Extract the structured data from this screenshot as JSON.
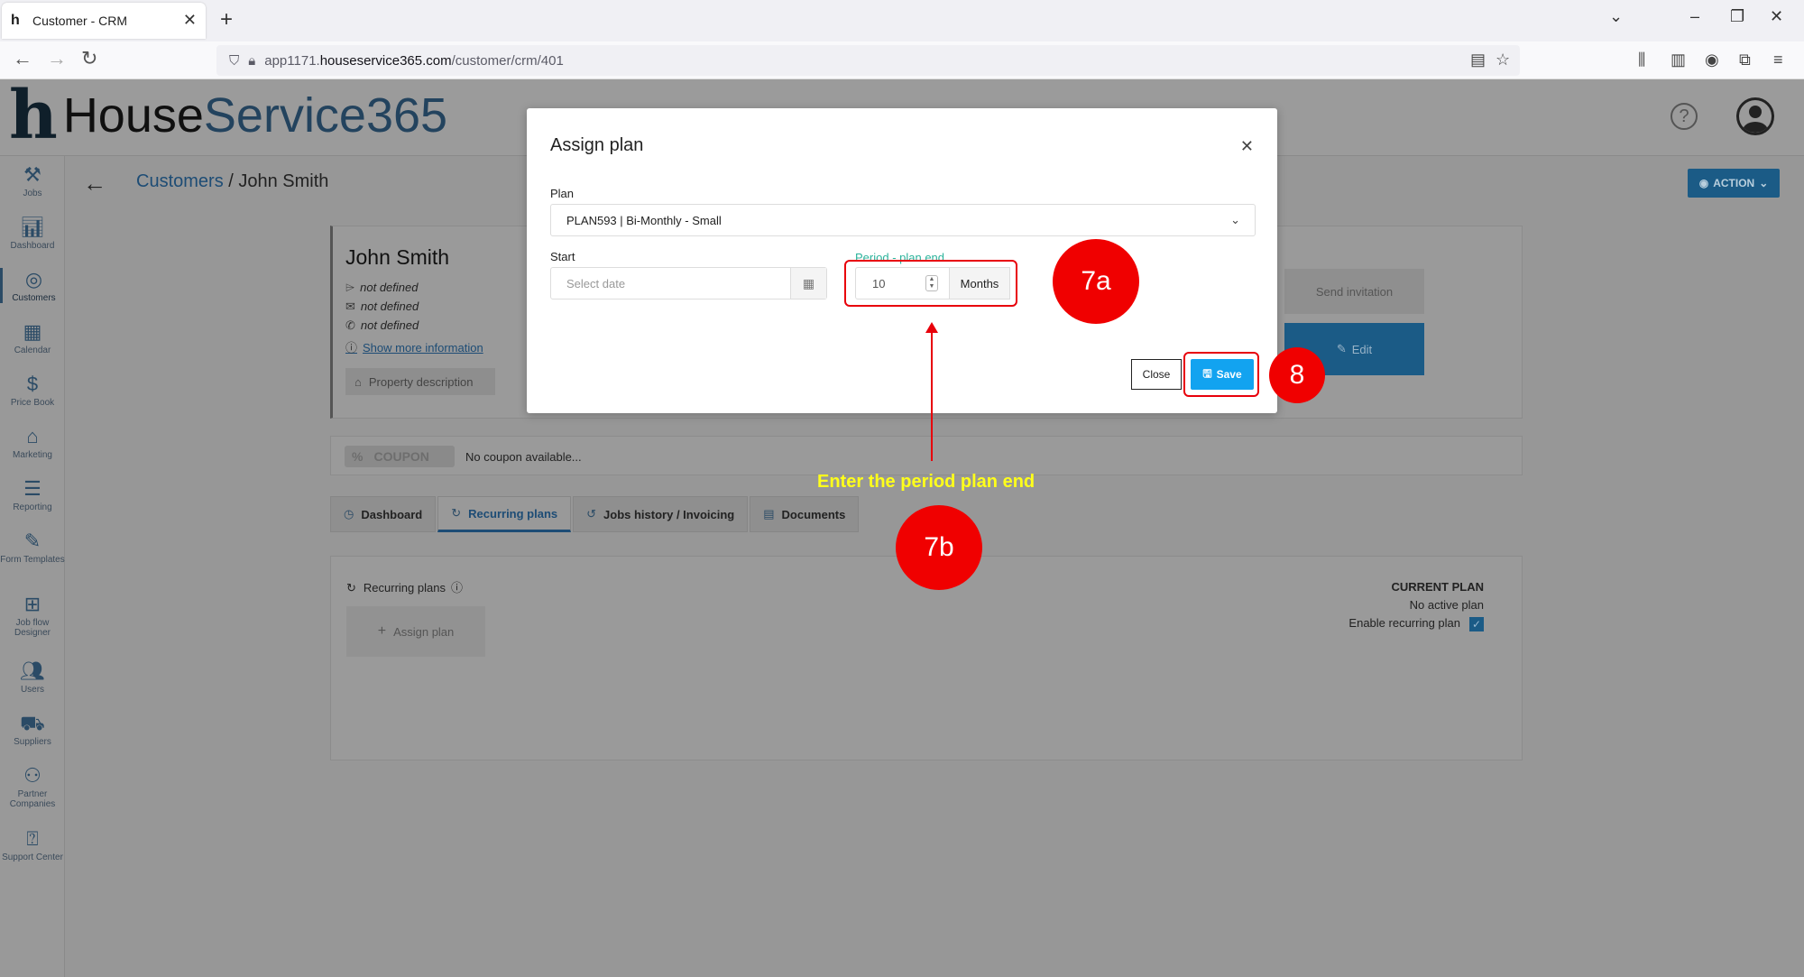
{
  "browser": {
    "tab_title": "Customer - CRM",
    "url_prefix": "app1171.",
    "url_host": "houseservice365.com",
    "url_path": "/customer/crm/401"
  },
  "app": {
    "logo_part1": "House",
    "logo_part2": "Service365",
    "sidebar": [
      {
        "label": "Jobs",
        "icon": "tools-icon"
      },
      {
        "label": "Dashboard",
        "icon": "chart-icon"
      },
      {
        "label": "Customers",
        "icon": "target-icon"
      },
      {
        "label": "Calendar",
        "icon": "calendar-icon"
      },
      {
        "label": "Price Book",
        "icon": "price-icon"
      },
      {
        "label": "Marketing",
        "icon": "tag-icon"
      },
      {
        "label": "Reporting",
        "icon": "report-icon"
      },
      {
        "label": "Form Templates",
        "icon": "form-icon"
      },
      {
        "label": "Job flow Designer",
        "icon": "flow-icon"
      },
      {
        "label": "Users",
        "icon": "users-icon"
      },
      {
        "label": "Suppliers",
        "icon": "truck-icon"
      },
      {
        "label": "Partner Companies",
        "icon": "partner-icon"
      },
      {
        "label": "Support Center",
        "icon": "help-icon"
      }
    ],
    "breadcrumb_link": "Customers",
    "breadcrumb_current": " / John Smith",
    "action_label": "ACTION",
    "customer": {
      "name": "John Smith",
      "field1": "not defined",
      "field2": "not defined",
      "field3": "not defined",
      "more_link": "Show more information",
      "property_btn": "Property description",
      "send_invitation": "Send invitation",
      "edit": "Edit"
    },
    "coupon": {
      "tag": "COUPON",
      "text": "No coupon available..."
    },
    "tabs": [
      {
        "label": "Dashboard"
      },
      {
        "label": "Recurring plans"
      },
      {
        "label": "Jobs history / Invoicing"
      },
      {
        "label": "Documents"
      }
    ],
    "recurring": {
      "title": "Recurring plans",
      "assign_btn": "Assign plan",
      "current_plan_heading": "CURRENT PLAN",
      "current_plan_value": "No active plan",
      "enable_label": "Enable recurring plan"
    }
  },
  "modal": {
    "title": "Assign plan",
    "plan_label": "Plan",
    "plan_value": "PLAN593 | Bi-Monthly - Small",
    "start_label": "Start",
    "start_placeholder": "Select date",
    "period_label": "Period - plan end",
    "period_value": "10",
    "period_unit": "Months",
    "close_btn": "Close",
    "save_btn": "Save"
  },
  "annotations": {
    "callout_7a": "7a",
    "callout_7b": "7b",
    "callout_8": "8",
    "hint": "Enter the period plan end",
    "accent_color": "#f00000"
  }
}
